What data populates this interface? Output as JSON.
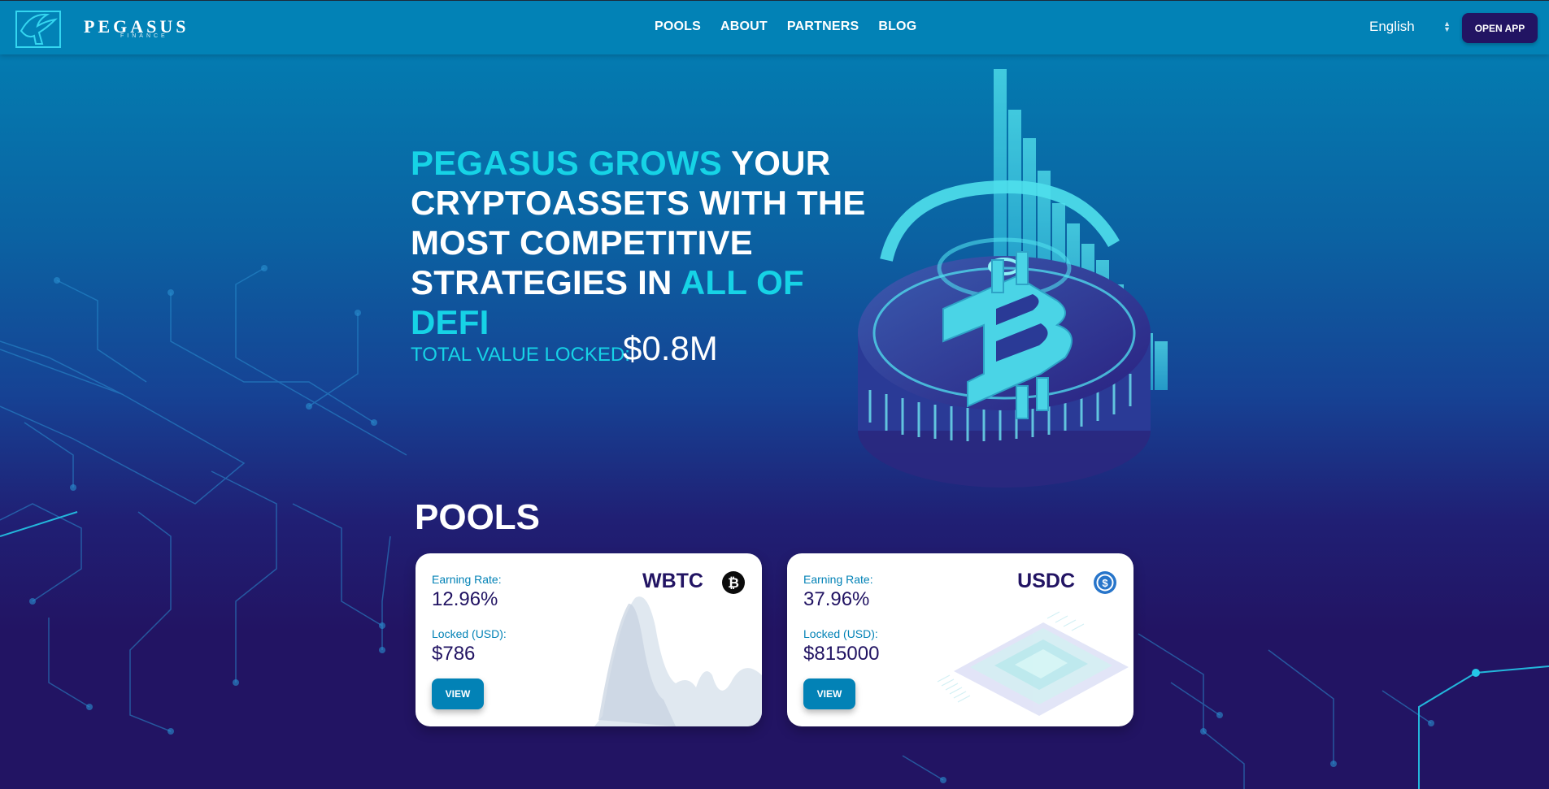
{
  "brand": {
    "name": "PEGASUS",
    "tagline": "FINANCE"
  },
  "nav": {
    "items": [
      "POOLS",
      "ABOUT",
      "PARTNERS",
      "BLOG"
    ]
  },
  "language": {
    "selected": "English"
  },
  "header": {
    "open_app_label": "OPEN APP"
  },
  "hero": {
    "title_part1": "PEGASUS GROWS",
    "title_part2": " YOUR CRYPTOASSETS WITH THE MOST COMPETITIVE STRATEGIES IN ",
    "title_part3": "ALL OF DEFI",
    "tvl_label": "TOTAL VALUE LOCKED:",
    "tvl_value": "$0.8M"
  },
  "pools": {
    "title": "POOLS",
    "cards": [
      {
        "asset": "WBTC",
        "icon": "bitcoin-icon",
        "rate_label": "Earning Rate:",
        "rate": "12.96%",
        "locked_label": "Locked (USD):",
        "locked": "$786",
        "button": "VIEW"
      },
      {
        "asset": "USDC",
        "icon": "usdc-icon",
        "rate_label": "Earning Rate:",
        "rate": "37.96%",
        "locked_label": "Locked (USD):",
        "locked": "$815000",
        "button": "VIEW"
      }
    ]
  },
  "colors": {
    "accent": "#16d3e6",
    "header": "#0282b6",
    "deep_purple": "#221463"
  },
  "icons": [
    "pegasus-logo-icon",
    "select-arrows-icon",
    "bitcoin-icon",
    "usdc-icon"
  ]
}
